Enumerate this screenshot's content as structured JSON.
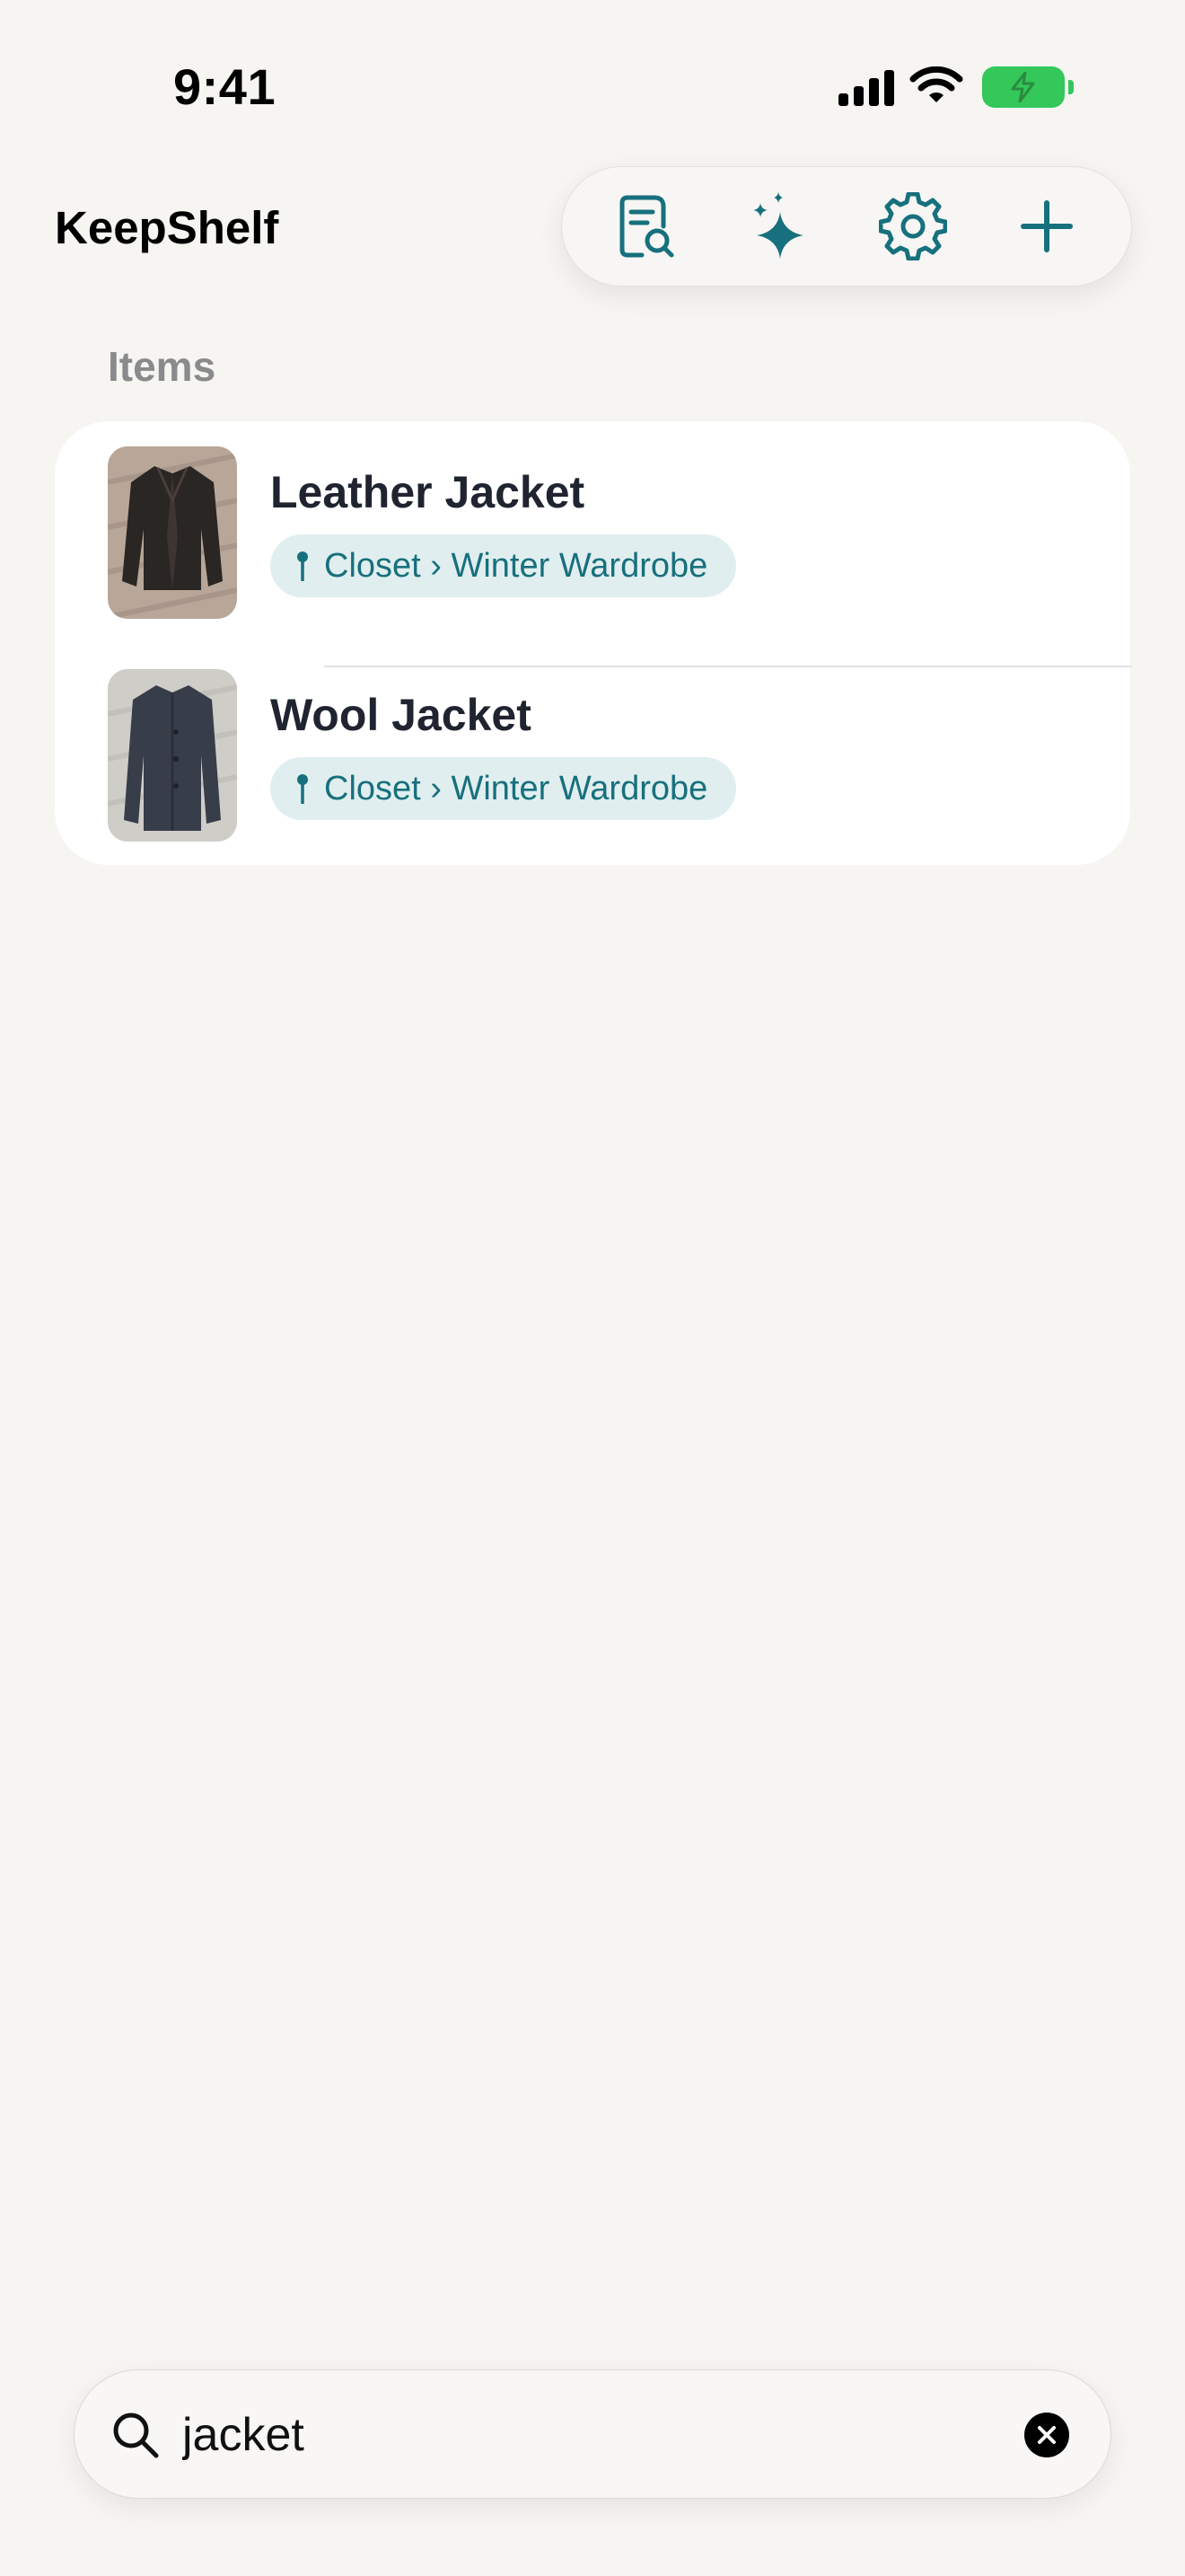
{
  "status": {
    "time": "9:41"
  },
  "app": {
    "title": "KeepShelf"
  },
  "toolbar": {
    "buttons": [
      {
        "icon": "document-search-icon"
      },
      {
        "icon": "sparkles-icon"
      },
      {
        "icon": "gear-icon"
      },
      {
        "icon": "plus-icon"
      }
    ],
    "accent": "#17707d"
  },
  "items_section": {
    "label": "Items",
    "items": [
      {
        "name": "Leather Jacket",
        "location": "Closet › Winter Wardrobe"
      },
      {
        "name": "Wool Jacket",
        "location": "Closet › Winter Wardrobe"
      }
    ]
  },
  "search": {
    "value": "jacket"
  }
}
